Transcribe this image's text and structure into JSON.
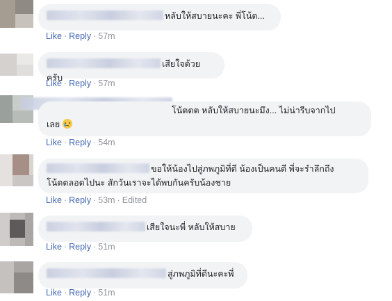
{
  "comments": [
    {
      "text": "หลับให้สบายนะคะ พี่โน้ต...",
      "like": "Like",
      "reply": "Reply",
      "time": "57m"
    },
    {
      "text": "เสียใจด้วยครับ",
      "like": "Like",
      "reply": "Reply",
      "time": "57m"
    },
    {
      "text_line1": "โน้ตตต หลับให้สบายนะมึง... ไม่น่ารีบจากไป",
      "text_line2": "เลย",
      "emoji": "crying-face-icon",
      "like": "Like",
      "reply": "Reply",
      "time": "54m"
    },
    {
      "text_line1": "ขอให้น้องไปสู่ภพภูมิที่ดี น้องเป็นคนดี พี่จะรำลึกถึง",
      "text_line2": "โน้ตตลอดไปนะ สักวันเราจะได้พบกันครับน้องชาย",
      "like": "Like",
      "reply": "Reply",
      "time": "53m",
      "edited": "Edited"
    },
    {
      "text": "เสียใจนะพี่ หลับให้สบาย",
      "like": "Like",
      "reply": "Reply",
      "time": "51m"
    },
    {
      "text": "สู่ภพภูมิที่ดีนะคะพี่",
      "like": "Like",
      "reply": "Reply",
      "time": "51m"
    }
  ],
  "separator": "·",
  "colors": {
    "link": "#4267b2",
    "meta": "#90949c",
    "bubble": "#f2f3f5",
    "text": "#1c1e21"
  }
}
